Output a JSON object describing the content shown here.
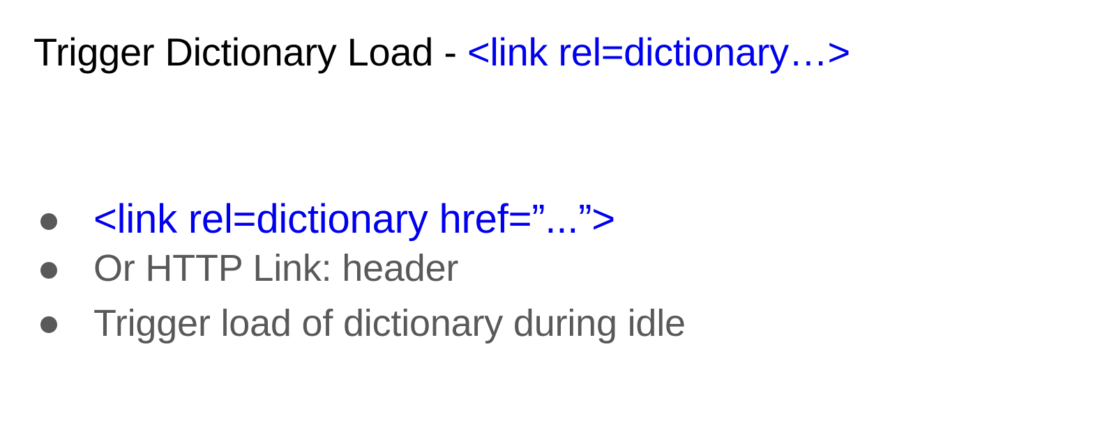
{
  "slide": {
    "title": {
      "main": "Trigger Dictionary Load - ",
      "code": "<link rel=dictionary…>"
    },
    "bullets": [
      {
        "text": "<link rel=dictionary href=”...”>",
        "style": "code"
      },
      {
        "text": "Or HTTP Link: header",
        "style": "body"
      },
      {
        "text": "Trigger load of dictionary during idle",
        "style": "body"
      }
    ]
  },
  "colors": {
    "title": "#000000",
    "code_link": "#0000ee",
    "body_text": "#595959",
    "bullet": "#595959",
    "background": "#ffffff"
  }
}
